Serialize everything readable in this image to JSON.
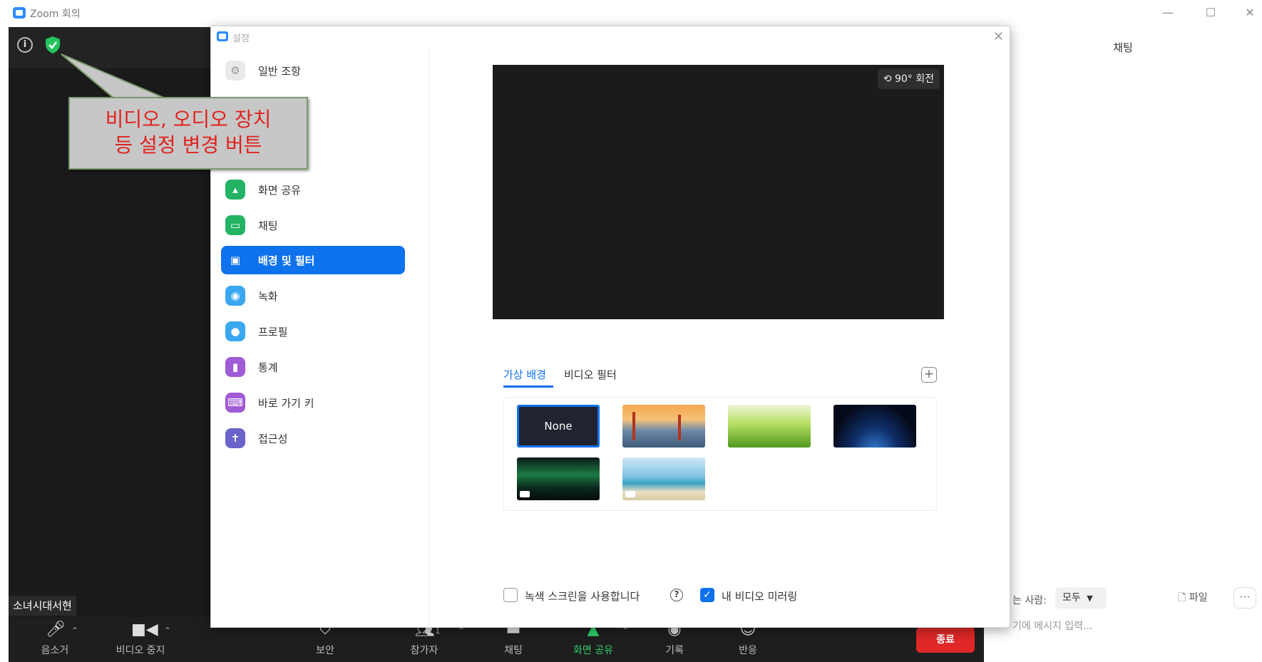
{
  "window": {
    "title": "Zoom 회의",
    "controls": {
      "minimize": "—",
      "maximize": "☐",
      "close": "✕"
    }
  },
  "callout": {
    "line1": "비디오, 오디오 장치",
    "line2": "등 설정 변경 버튼"
  },
  "meeting": {
    "participant_name": "소녀시대서현",
    "toolbar": {
      "mute_label": "음소거",
      "video_label": "비디오 중지",
      "security_label": "보안",
      "participants_label": "참가자",
      "participants_count": "1",
      "chat_label": "채팅",
      "share_label": "화면 공유",
      "record_label": "기록",
      "reactions_label": "반응",
      "end_label": "종료"
    }
  },
  "chat": {
    "title": "채팅",
    "to_label": "는 사람:",
    "to_value": "모두",
    "file_label": "파일",
    "more_label": "···",
    "input_placeholder": "기에 메시지 입력..."
  },
  "settings": {
    "title": "설정",
    "close": "✕",
    "nav": [
      {
        "label": "일반 조항",
        "icon": "gear-icon",
        "color": "#e9e9e9",
        "glyph": "⚙"
      },
      {
        "label": "화면 공유",
        "icon": "share-screen-icon",
        "color": "#23b364",
        "glyph": "▲"
      },
      {
        "label": "채팅",
        "icon": "chat-icon",
        "color": "#23b364",
        "glyph": "▭"
      },
      {
        "label": "배경 및 필터",
        "icon": "background-icon",
        "color": "#0e72ed",
        "glyph": "▣",
        "active": true
      },
      {
        "label": "녹화",
        "icon": "record-icon",
        "color": "#3aa7f0",
        "glyph": "◉"
      },
      {
        "label": "프로필",
        "icon": "profile-icon",
        "color": "#3aa7f0",
        "glyph": "●"
      },
      {
        "label": "통계",
        "icon": "statistics-icon",
        "color": "#a05bd6",
        "glyph": "▮"
      },
      {
        "label": "바로 가기 키",
        "icon": "keyboard-icon",
        "color": "#a05bd6",
        "glyph": "⌨"
      },
      {
        "label": "접근성",
        "icon": "accessibility-icon",
        "color": "#6a63c9",
        "glyph": "✝"
      }
    ],
    "preview": {
      "rotate_label": "⟲ 90° 회전"
    },
    "tabs": [
      {
        "label": "가상 배경",
        "active": true
      },
      {
        "label": "비디오 필터",
        "active": false
      }
    ],
    "add_background": "+",
    "backgrounds": [
      {
        "name": "none",
        "label": "None",
        "selected": true
      },
      {
        "name": "golden-gate",
        "selected": false
      },
      {
        "name": "grass",
        "selected": false
      },
      {
        "name": "earth-from-space",
        "selected": false
      },
      {
        "name": "aurora",
        "selected": false,
        "video": true
      },
      {
        "name": "beach",
        "selected": false,
        "video": true
      }
    ],
    "options": {
      "green_screen_label": "녹색 스크린을 사용합니다",
      "green_screen_checked": false,
      "help": "?",
      "mirror_label": "내 비디오 미러링",
      "mirror_checked": true,
      "check_glyph": "✓"
    }
  }
}
